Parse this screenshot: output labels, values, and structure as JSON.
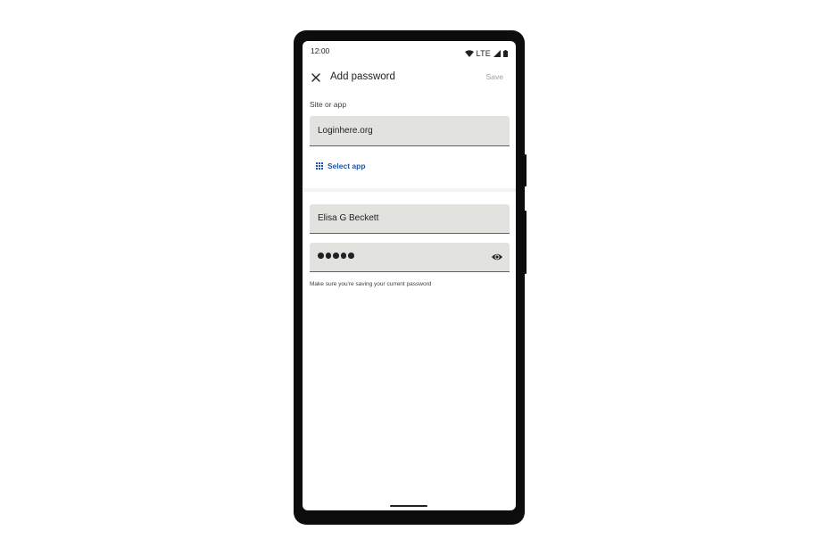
{
  "status_bar": {
    "time": "12:00",
    "network": "LTE",
    "icons": [
      "wifi-icon",
      "cell-signal-icon",
      "battery-icon"
    ]
  },
  "top_bar": {
    "title": "Add password",
    "save_label": "Save",
    "close_icon": "close-icon"
  },
  "site_section": {
    "label": "Site or app",
    "value": "Loginhere.org",
    "select_app_label": "Select app",
    "select_app_icon": "grid-apps-icon"
  },
  "username": {
    "value": "Elisa G Beckett"
  },
  "password": {
    "masked_length": 5,
    "toggle_icon": "eye-icon"
  },
  "hint": "Make sure you're saving your current password",
  "colors": {
    "field_bg": "#e2e3de",
    "link": "#1a56b0",
    "save_disabled": "#9aa0a6",
    "frame": "#0d0d0d"
  }
}
